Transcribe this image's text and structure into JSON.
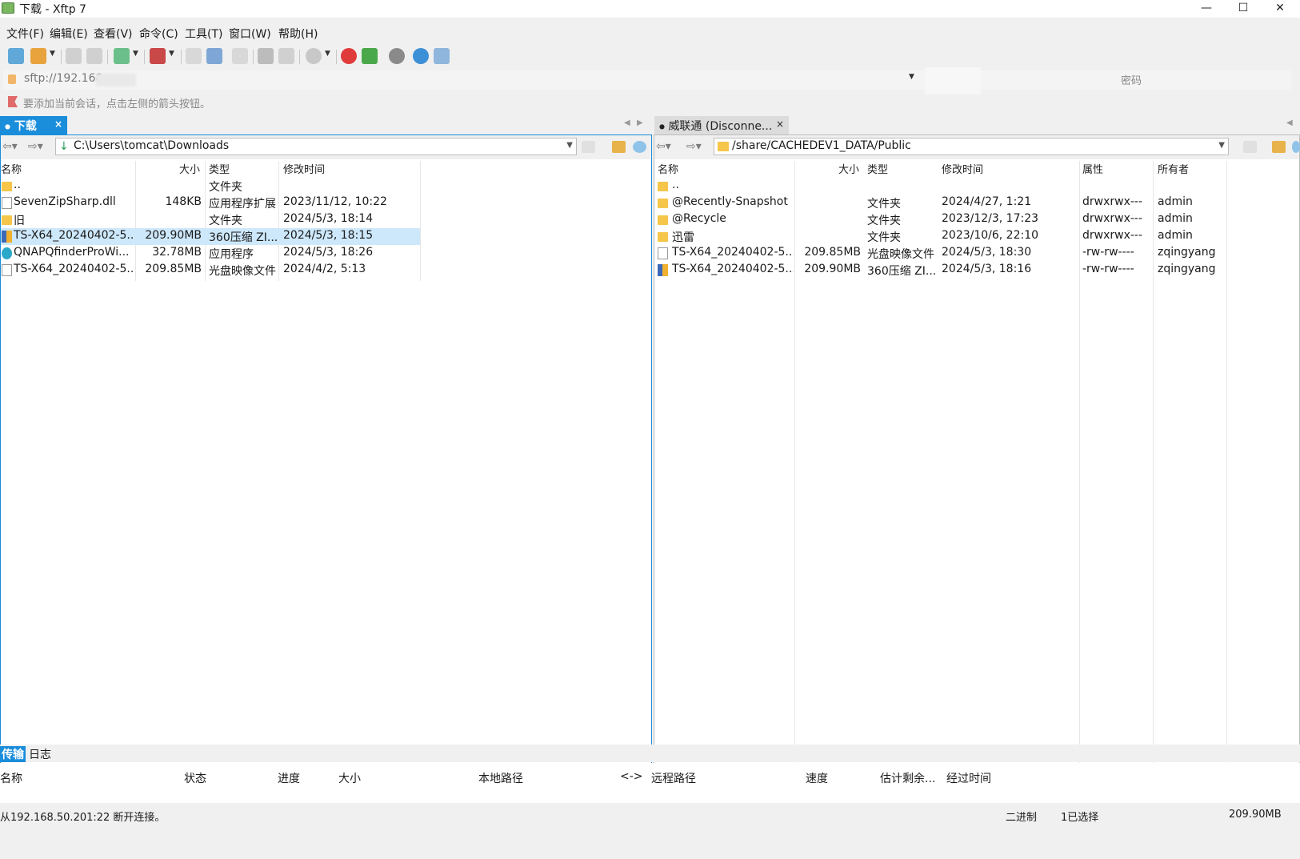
{
  "window": {
    "title": "下载 - Xftp 7",
    "minimize": "—",
    "maximize": "☐",
    "close": "✕"
  },
  "menu": [
    "文件(F)",
    "编辑(E)",
    "查看(V)",
    "命令(C)",
    "工具(T)",
    "窗口(W)",
    "帮助(H)"
  ],
  "toolbar_icons": [
    "new-session-icon",
    "open-folder-icon",
    "connect-icon",
    "disconnect-icon",
    "session-manager-icon",
    "transfer-icon",
    "copy-icon",
    "sync-icon",
    "print-icon",
    "paste-icon",
    "stop-icon",
    "xshell-icon",
    "xftp-icon",
    "settings-icon",
    "help-icon",
    "chat-icon"
  ],
  "address": {
    "url": "sftp://192.168",
    "password_placeholder": "密码"
  },
  "hint": "要添加当前会话，点击左侧的箭头按钮。",
  "tabs": {
    "local": {
      "label": "下载",
      "close": "×"
    },
    "remote": {
      "label": "威联通 (Disconne...",
      "close": "×"
    }
  },
  "local": {
    "path": "C:\\Users\\tomcat\\Downloads",
    "columns": {
      "name": "名称",
      "size": "大小",
      "type": "类型",
      "modified": "修改时间"
    },
    "rows": [
      {
        "name": "..",
        "size": "",
        "type": "文件夹",
        "modified": "",
        "icon": "folder"
      },
      {
        "name": "SevenZipSharp.dll",
        "size": "148KB",
        "type": "应用程序扩展",
        "modified": "2023/11/12, 10:22",
        "icon": "file"
      },
      {
        "name": "旧",
        "size": "",
        "type": "文件夹",
        "modified": "2024/5/3, 18:14",
        "icon": "folder"
      },
      {
        "name": "TS-X64_20240402-5....",
        "size": "209.90MB",
        "type": "360压缩 ZI...",
        "modified": "2024/5/3, 18:15",
        "icon": "zip",
        "selected": true
      },
      {
        "name": "QNAPQfinderProWi...",
        "size": "32.78MB",
        "type": "应用程序",
        "modified": "2024/5/3, 18:26",
        "icon": "app"
      },
      {
        "name": "TS-X64_20240402-5....",
        "size": "209.85MB",
        "type": "光盘映像文件",
        "modified": "2024/4/2, 5:13",
        "icon": "file"
      }
    ]
  },
  "remote": {
    "path": "/share/CACHEDEV1_DATA/Public",
    "columns": {
      "name": "名称",
      "size": "大小",
      "type": "类型",
      "modified": "修改时间",
      "attr": "属性",
      "owner": "所有者"
    },
    "rows": [
      {
        "name": "..",
        "size": "",
        "type": "",
        "modified": "",
        "attr": "",
        "owner": "",
        "icon": "folder"
      },
      {
        "name": "@Recently-Snapshot",
        "size": "",
        "type": "文件夹",
        "modified": "2024/4/27, 1:21",
        "attr": "drwxrwx---",
        "owner": "admin",
        "icon": "folder"
      },
      {
        "name": "@Recycle",
        "size": "",
        "type": "文件夹",
        "modified": "2023/12/3, 17:23",
        "attr": "drwxrwx---",
        "owner": "admin",
        "icon": "folder"
      },
      {
        "name": "迅雷",
        "size": "",
        "type": "文件夹",
        "modified": "2023/10/6, 22:10",
        "attr": "drwxrwx---",
        "owner": "admin",
        "icon": "folder"
      },
      {
        "name": "TS-X64_20240402-5....",
        "size": "209.85MB",
        "type": "光盘映像文件",
        "modified": "2024/5/3, 18:30",
        "attr": "-rw-rw----",
        "owner": "zqingyang",
        "icon": "file"
      },
      {
        "name": "TS-X64_20240402-5....",
        "size": "209.90MB",
        "type": "360压缩 ZI...",
        "modified": "2024/5/3, 18:16",
        "attr": "-rw-rw----",
        "owner": "zqingyang",
        "icon": "zip"
      }
    ]
  },
  "transfer": {
    "tabs": [
      "传输",
      "日志"
    ],
    "columns": [
      "名称",
      "状态",
      "进度",
      "大小",
      "本地路径",
      "<->",
      "远程路径",
      "速度",
      "估计剩余...",
      "经过时间"
    ]
  },
  "status": {
    "message": "从192.168.50.201:22 断开连接。",
    "mode": "二进制",
    "selected": "1已选择",
    "size": "209.90MB"
  },
  "colors": {
    "accent": "#1a8ddb",
    "selection": "#cde8fb",
    "folder": "#f6c64a"
  }
}
